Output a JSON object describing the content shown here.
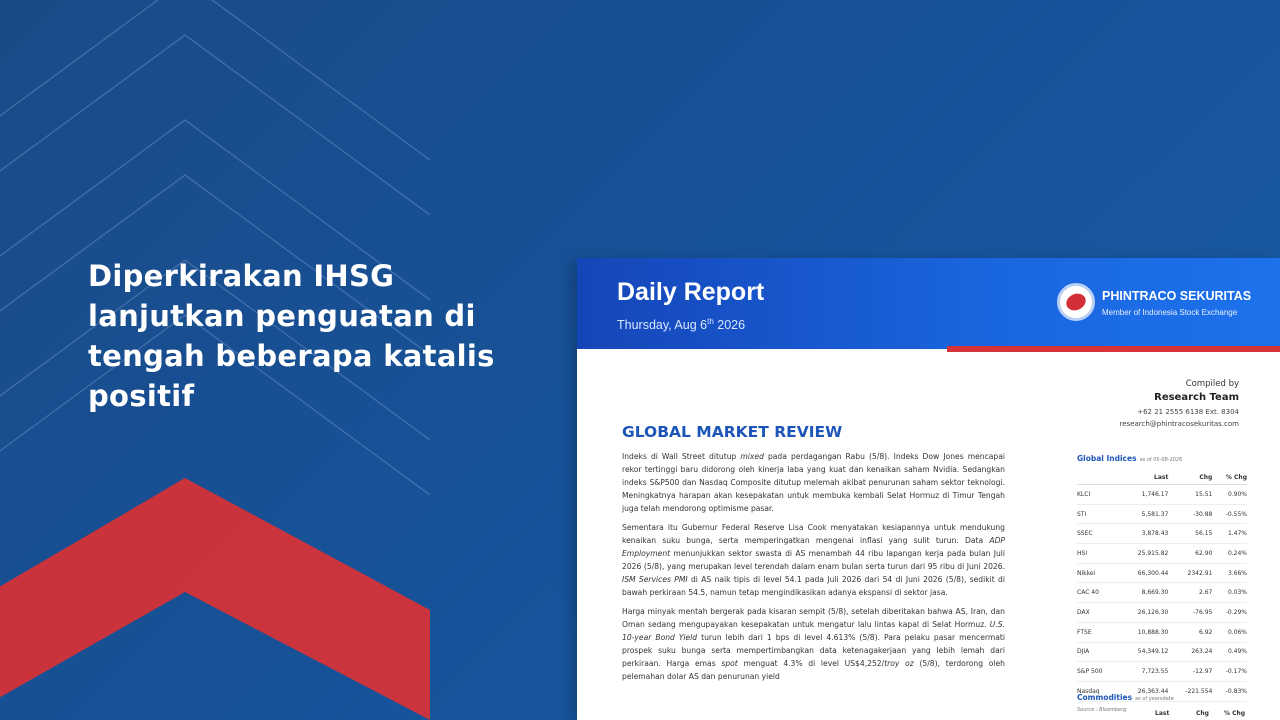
{
  "headline": "Diperkirakan IHSG lanjutkan penguatan di tengah beberapa katalis positif",
  "colors": {
    "background": "#16539a",
    "accent_red": "#d63338",
    "doc_header_blue": "#1a66e0",
    "section_blue": "#1d56b8"
  },
  "report": {
    "title": "Daily Report",
    "date_prefix": "Thursday, Aug 6",
    "date_suffix": "th",
    "date_year": " 2026",
    "brand_name": "PHINTRACO SEKURITAS",
    "brand_subtitle": "Member of Indonesia Stock Exchange",
    "compiled_label": "Compiled by",
    "compiled_team": "Research Team",
    "compiled_phone": "+62 21 2555 6138  Ext. 8304",
    "compiled_email": "research@phintracosekuritas.com",
    "section_title": "GLOBAL MARKET REVIEW",
    "p1_a": "Indeks di Wall Street ditutup ",
    "p1_em": "mixed",
    "p1_b": " pada perdagangan Rabu (5/8). Indeks Dow Jones mencapai rekor tertinggi baru didorong oleh kinerja laba yang kuat dan kenaikan saham Nvidia. Sedangkan indeks S&P500 dan Nasdaq Composite ditutup melemah akibat penurunan saham sektor teknologi. Meningkatnya harapan akan kesepakatan untuk membuka kembali Selat Hormuz di Timur Tengah juga telah mendorong optimisme pasar.",
    "p2_a": "Sementara itu Gubernur Federal Reserve Lisa Cook menyatakan kesiapannya untuk mendukung kenaikan suku bunga, serta memperingatkan mengenai inflasi yang sulit turun. Data ",
    "p2_em1": "ADP Employment",
    "p2_b": " menunjukkan sektor swasta di AS menambah 44 ribu lapangan kerja pada bulan Juli 2026 (5/8), yang merupakan level terendah dalam enam bulan serta turun dari 95 ribu di Juni 2026. ",
    "p2_em2": "ISM Services PMI",
    "p2_c": " di AS naik tipis di level 54.1 pada Juli 2026 dari 54 di Juni 2026 (5/8), sedikit di bawah perkiraan 54.5, namun tetap mengindikasikan adanya ekspansi di sektor jasa.",
    "p3_a": "Harga minyak mentah bergerak pada kisaran sempit (5/8), setelah diberitakan bahwa AS, Iran, dan Oman sedang mengupayakan kesepakatan untuk mengatur lalu lintas kapal di Selat Hormuz. ",
    "p3_em1": "U.S. 10-year Bond Yield",
    "p3_b": " turun lebih dari 1 bps di level 4.613% (5/8). Para pelaku pasar mencermati prospek suku bunga serta mempertimbangkan data ketenagakerjaan yang lebih lemah dari perkiraan. Harga emas ",
    "p3_em2": "spot",
    "p3_c": " menguat 4.3% di level US$4,252/",
    "p3_em3": "troy oz",
    "p3_d": " (5/8), terdorong oleh pelemahan dolar AS dan penurunan yield"
  },
  "global_indices": {
    "title": "Global Indices",
    "as_of": "as of 05-08-2026",
    "columns": [
      "",
      "Last",
      "Chg",
      "% Chg"
    ],
    "rows": [
      [
        "KLCI",
        "1,746.17",
        "15.51",
        "0.90%"
      ],
      [
        "STI",
        "5,581.37",
        "-30.88",
        "-0.55%"
      ],
      [
        "SSEC",
        "3,878.43",
        "56.15",
        "1.47%"
      ],
      [
        "HSI",
        "25,915.82",
        "62.90",
        "0.24%"
      ],
      [
        "Nikkei",
        "66,300.44",
        "2342.91",
        "3.66%"
      ],
      [
        "CAC 40",
        "8,669.30",
        "2.67",
        "0.03%"
      ],
      [
        "DAX",
        "26,126.30",
        "-76.95",
        "-0.29%"
      ],
      [
        "FTSE",
        "10,888.30",
        "6.92",
        "0.06%"
      ],
      [
        "DJIA",
        "54,349.12",
        "263.24",
        "0.49%"
      ],
      [
        "S&P 500",
        "7,723.55",
        "-12.97",
        "-0.17%"
      ],
      [
        "Nasdaq",
        "26,363.44",
        "-221.554",
        "-0.83%"
      ]
    ],
    "source": "Source : Bloomberg"
  },
  "commodities": {
    "title": "Commodities",
    "as_of": "as of yearsdate",
    "col_last": "Last",
    "col_chg": "Chg",
    "col_pct": "% Chg"
  }
}
